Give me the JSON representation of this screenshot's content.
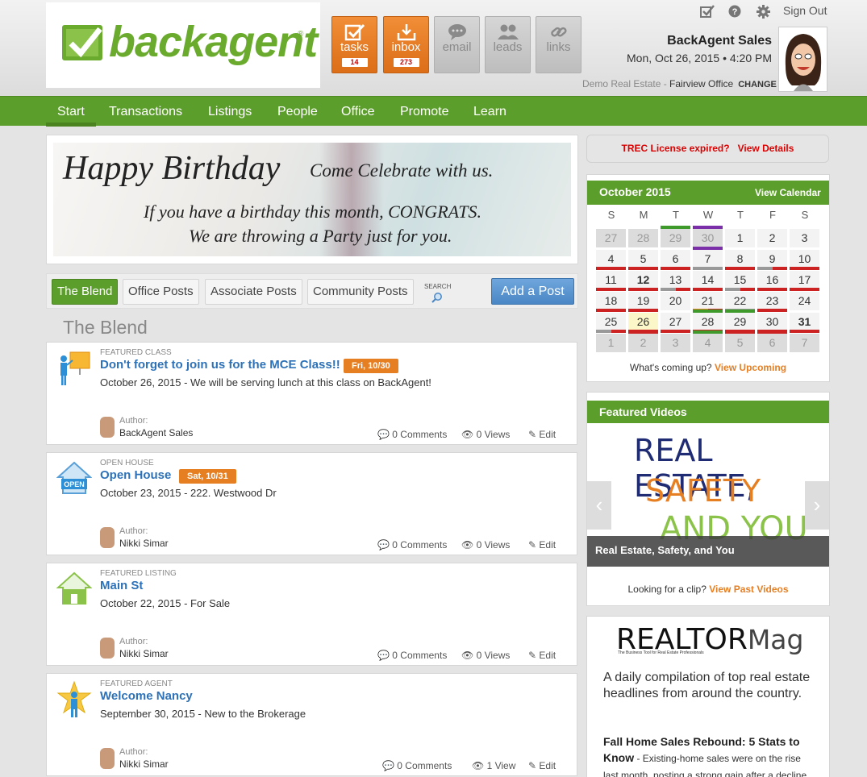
{
  "brand": {
    "name": "backagent",
    "reg": "®"
  },
  "toolbar": [
    {
      "id": "tasks",
      "label": "tasks",
      "count": "14",
      "style": "orange",
      "icon": "checkbox-icon"
    },
    {
      "id": "inbox",
      "label": "inbox",
      "count": "273",
      "style": "orange",
      "icon": "inbox-download-icon"
    },
    {
      "id": "email",
      "label": "email",
      "style": "grey",
      "icon": "speech-bubble-icon"
    },
    {
      "id": "leads",
      "label": "leads",
      "style": "grey",
      "icon": "people-icon"
    },
    {
      "id": "links",
      "label": "links",
      "style": "grey",
      "icon": "link-icon"
    }
  ],
  "header": {
    "signout": "Sign Out",
    "user_name": "BackAgent Sales",
    "datetime": "Mon, Oct 26, 2015 • 4:20 PM",
    "office_prefix": "Demo Real Estate - ",
    "office_name": "Fairview Office",
    "change": "CHANGE"
  },
  "nav": [
    "Start",
    "Transactions",
    "Listings",
    "People",
    "Office",
    "Promote",
    "Learn"
  ],
  "banner": {
    "line1": "Happy Birthday",
    "line2": "Come Celebrate with us.",
    "line3": "If you have a birthday this month, CONGRATS.",
    "line4": "We are throwing a Party just for you."
  },
  "tabs": [
    "The Blend",
    "Office Posts",
    "Associate Posts",
    "Community Posts"
  ],
  "search_label": "SEARCH",
  "add_post": "Add a Post",
  "blend_title": "The Blend",
  "posts": [
    {
      "type": "FEATURED CLASS",
      "title": "Don't forget to join us for the MCE Class!!",
      "badge": "Fri, 10/30",
      "desc": "October 26, 2015 - We will be serving lunch at this class on BackAgent!",
      "author_label": "Author:",
      "author": "BackAgent Sales",
      "comments": "0 Comments",
      "views": "0 Views",
      "edit": "Edit",
      "icon": "presentation-icon"
    },
    {
      "type": "OPEN HOUSE",
      "title": "Open House",
      "badge": "Sat, 10/31",
      "desc": "October 23, 2015 - 222. Westwood Dr",
      "author_label": "Author:",
      "author": "Nikki Simar",
      "comments": "0 Comments",
      "views": "0 Views",
      "edit": "Edit",
      "icon": "open-house-icon",
      "icon_text": "OPEN"
    },
    {
      "type": "FEATURED LISTING",
      "title": "Main St",
      "badge": "",
      "desc": "October 22, 2015 - For Sale",
      "author_label": "Author:",
      "author": "Nikki Simar",
      "comments": "0 Comments",
      "views": "0 Views",
      "edit": "Edit",
      "icon": "house-icon"
    },
    {
      "type": "FEATURED AGENT",
      "title": "Welcome Nancy",
      "badge": "",
      "desc": "September 30, 2015 - New to the Brokerage",
      "author_label": "Author:",
      "author": "Nikki Simar",
      "comments": "0 Comments",
      "views": "1 View",
      "edit": "Edit",
      "icon": "star-person-icon"
    }
  ],
  "trec": {
    "text": "TREC License expired?",
    "link": "View Details"
  },
  "calendar": {
    "month": "October 2015",
    "view_link": "View Calendar",
    "dow": [
      "S",
      "M",
      "T",
      "W",
      "T",
      "F",
      "S"
    ],
    "weeks": [
      [
        "27",
        "28",
        "29",
        "30",
        "1",
        "2",
        "3"
      ],
      [
        "4",
        "5",
        "6",
        "7",
        "8",
        "9",
        "10"
      ],
      [
        "11",
        "12",
        "13",
        "14",
        "15",
        "16",
        "17"
      ],
      [
        "18",
        "19",
        "20",
        "21",
        "22",
        "23",
        "24"
      ],
      [
        "25",
        "26",
        "27",
        "28",
        "29",
        "30",
        "31"
      ],
      [
        "1",
        "2",
        "3",
        "4",
        "5",
        "6",
        "7"
      ]
    ],
    "footer_text": "What's coming up?",
    "footer_link": "View Upcoming"
  },
  "videos": {
    "title": "Featured Videos",
    "art_line1": "REAL ESTATE,",
    "art_line2": "SAFETY",
    "art_line3": "AND YOU",
    "caption": "Real Estate, Safety, and You",
    "prev": "‹",
    "next": "›",
    "footer_text": "Looking for a clip?",
    "footer_link": "View Past Videos"
  },
  "realtor": {
    "logo": "REALTOR",
    "logo_mag": "Mag",
    "tagline": "The Business Tool for Real Estate Professionals",
    "desc": "A daily compilation of top real estate headlines from around the country.",
    "headline": "Fall Home Sales Rebound: 5 Stats to Know",
    "body": " - Existing-home sales were on the rise last month, posting a strong gain after a decline"
  },
  "colors": {
    "green": "#5c9e2b",
    "orange": "#e67e22",
    "blue_link": "#2d72b8",
    "red": "#cc2222"
  }
}
